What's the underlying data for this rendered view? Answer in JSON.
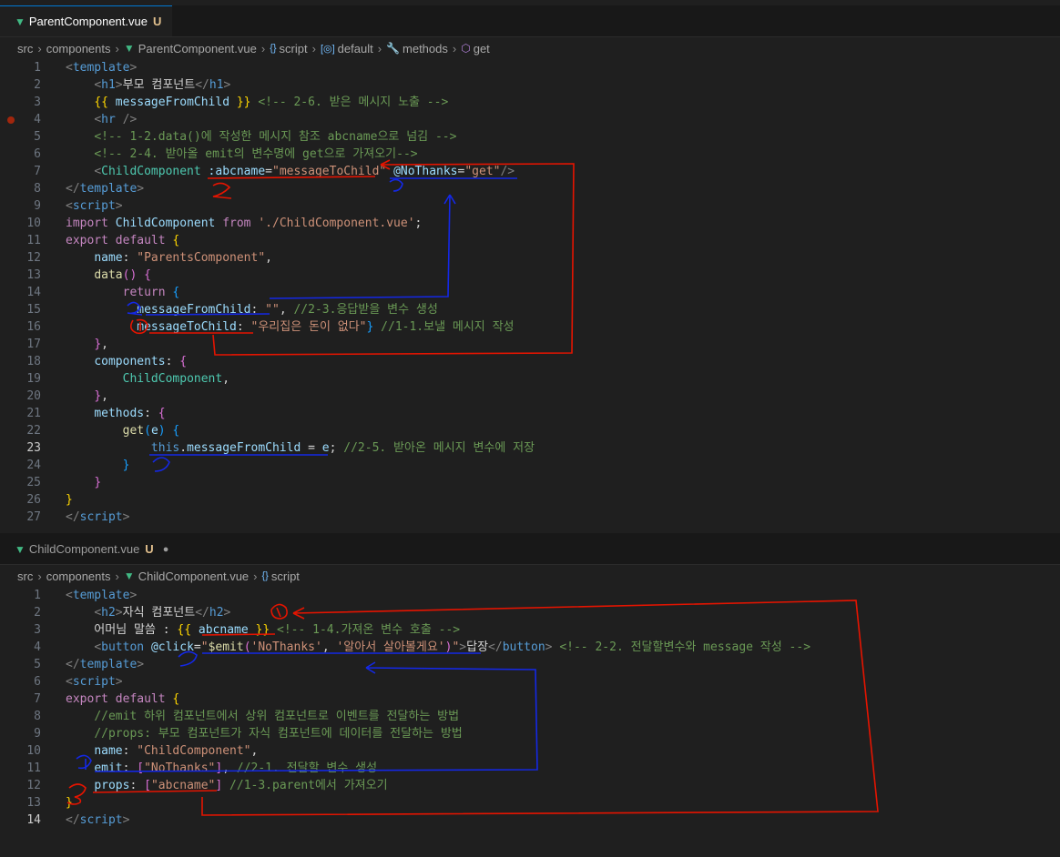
{
  "top": {
    "tab": {
      "label": "ParentComponent.vue",
      "status": "U"
    },
    "breadcrumb": [
      "src",
      "components",
      "ParentComponent.vue",
      "script",
      "default",
      "methods",
      "get"
    ],
    "lines": [
      {
        "n": "1",
        "parts": [
          [
            "t-br",
            "<"
          ],
          [
            "t-tag",
            "template"
          ],
          [
            "t-br",
            ">"
          ]
        ]
      },
      {
        "n": "2",
        "parts": [
          [
            "t-txt",
            "    "
          ],
          [
            "t-br",
            "<"
          ],
          [
            "t-tag",
            "h1"
          ],
          [
            "t-br",
            ">"
          ],
          [
            "t-txt",
            "부모 컴포넌트"
          ],
          [
            "t-br",
            "</"
          ],
          [
            "t-tag",
            "h1"
          ],
          [
            "t-br",
            ">"
          ]
        ]
      },
      {
        "n": "3",
        "parts": [
          [
            "t-txt",
            "    "
          ],
          [
            "t-gold",
            "{{"
          ],
          [
            "t-txt",
            " "
          ],
          [
            "t-var",
            "messageFromChild"
          ],
          [
            "t-txt",
            " "
          ],
          [
            "t-gold",
            "}}"
          ],
          [
            "t-txt",
            " "
          ],
          [
            "t-com",
            "<!-- 2-6. 받은 메시지 노출 -->"
          ]
        ]
      },
      {
        "n": "4",
        "bp": true,
        "parts": [
          [
            "t-txt",
            "    "
          ],
          [
            "t-br",
            "<"
          ],
          [
            "t-tag",
            "hr"
          ],
          [
            "t-txt",
            " "
          ],
          [
            "t-br",
            "/>"
          ]
        ]
      },
      {
        "n": "5",
        "parts": [
          [
            "t-txt",
            "    "
          ],
          [
            "t-com",
            "<!-- 1-2.data()에 작성한 메시지 참조 abcname으로 넘김 -->"
          ]
        ]
      },
      {
        "n": "6",
        "parts": [
          [
            "t-txt",
            "    "
          ],
          [
            "t-com",
            "<!-- 2-4. 받아올 emit의 변수명에 get으로 가져오기-->"
          ]
        ]
      },
      {
        "n": "7",
        "parts": [
          [
            "t-txt",
            "    "
          ],
          [
            "t-br",
            "<"
          ],
          [
            "t-cls",
            "ChildComponent"
          ],
          [
            "t-txt",
            " "
          ],
          [
            "t-attr",
            ":abcname"
          ],
          [
            "t-txt",
            "="
          ],
          [
            "t-str",
            "\"messageToChild\""
          ],
          [
            "t-txt",
            " "
          ],
          [
            "t-attr",
            "@NoThanks"
          ],
          [
            "t-txt",
            "="
          ],
          [
            "t-str",
            "\"get\""
          ],
          [
            "t-br",
            "/>"
          ]
        ]
      },
      {
        "n": "8",
        "parts": [
          [
            "t-br",
            "</"
          ],
          [
            "t-tag",
            "template"
          ],
          [
            "t-br",
            ">"
          ]
        ]
      },
      {
        "n": "9",
        "parts": [
          [
            "t-br",
            "<"
          ],
          [
            "t-tag",
            "script"
          ],
          [
            "t-br",
            ">"
          ]
        ]
      },
      {
        "n": "10",
        "parts": [
          [
            "t-kw",
            "import"
          ],
          [
            "t-txt",
            " "
          ],
          [
            "t-var",
            "ChildComponent"
          ],
          [
            "t-txt",
            " "
          ],
          [
            "t-kw",
            "from"
          ],
          [
            "t-txt",
            " "
          ],
          [
            "t-str",
            "'./ChildComponent.vue'"
          ],
          [
            "t-txt",
            ";"
          ]
        ]
      },
      {
        "n": "11",
        "parts": [
          [
            "t-kw",
            "export"
          ],
          [
            "t-txt",
            " "
          ],
          [
            "t-kw",
            "default"
          ],
          [
            "t-txt",
            " "
          ],
          [
            "t-gold",
            "{"
          ]
        ]
      },
      {
        "n": "12",
        "parts": [
          [
            "t-txt",
            "    "
          ],
          [
            "t-var",
            "name"
          ],
          [
            "t-txt",
            ": "
          ],
          [
            "t-str",
            "\"ParentsComponent\""
          ],
          [
            "t-txt",
            ","
          ]
        ]
      },
      {
        "n": "13",
        "parts": [
          [
            "t-txt",
            "    "
          ],
          [
            "t-fn",
            "data"
          ],
          [
            "t-pink",
            "()"
          ],
          [
            "t-txt",
            " "
          ],
          [
            "t-pink",
            "{"
          ]
        ]
      },
      {
        "n": "14",
        "parts": [
          [
            "t-txt",
            "        "
          ],
          [
            "t-kw",
            "return"
          ],
          [
            "t-txt",
            " "
          ],
          [
            "t-cbr",
            "{"
          ]
        ]
      },
      {
        "n": "15",
        "parts": [
          [
            "t-txt",
            "          "
          ],
          [
            "t-var",
            "messageFromChild"
          ],
          [
            "t-txt",
            ": "
          ],
          [
            "t-str",
            "\"\""
          ],
          [
            "t-txt",
            ", "
          ],
          [
            "t-com",
            "//2-3.응답받을 변수 생성"
          ]
        ]
      },
      {
        "n": "16",
        "parts": [
          [
            "t-txt",
            "          "
          ],
          [
            "t-var",
            "messageToChild"
          ],
          [
            "t-txt",
            ": "
          ],
          [
            "t-str",
            "\"우리집은 돈이 없다\""
          ],
          [
            "t-cbr",
            "}"
          ],
          [
            "t-txt",
            " "
          ],
          [
            "t-com",
            "//1-1.보낼 메시지 작성"
          ]
        ]
      },
      {
        "n": "17",
        "parts": [
          [
            "t-txt",
            "    "
          ],
          [
            "t-pink",
            "}"
          ],
          [
            "t-txt",
            ","
          ]
        ]
      },
      {
        "n": "18",
        "parts": [
          [
            "t-txt",
            "    "
          ],
          [
            "t-var",
            "components"
          ],
          [
            "t-txt",
            ": "
          ],
          [
            "t-pink",
            "{"
          ]
        ]
      },
      {
        "n": "19",
        "parts": [
          [
            "t-txt",
            "        "
          ],
          [
            "t-cls",
            "ChildComponent"
          ],
          [
            "t-txt",
            ","
          ]
        ]
      },
      {
        "n": "20",
        "parts": [
          [
            "t-txt",
            "    "
          ],
          [
            "t-pink",
            "}"
          ],
          [
            "t-txt",
            ","
          ]
        ]
      },
      {
        "n": "21",
        "parts": [
          [
            "t-txt",
            "    "
          ],
          [
            "t-var",
            "methods"
          ],
          [
            "t-txt",
            ": "
          ],
          [
            "t-pink",
            "{"
          ]
        ]
      },
      {
        "n": "22",
        "parts": [
          [
            "t-txt",
            "        "
          ],
          [
            "t-fn",
            "get"
          ],
          [
            "t-cbr",
            "("
          ],
          [
            "t-var",
            "e"
          ],
          [
            "t-cbr",
            ")"
          ],
          [
            "t-txt",
            " "
          ],
          [
            "t-cbr",
            "{"
          ]
        ]
      },
      {
        "n": "23",
        "cur": true,
        "parts": [
          [
            "t-txt",
            "            "
          ],
          [
            "t-blue",
            "this"
          ],
          [
            "t-txt",
            "."
          ],
          [
            "t-var",
            "messageFromChild"
          ],
          [
            "t-txt",
            " = "
          ],
          [
            "t-var",
            "e"
          ],
          [
            "t-txt",
            "; "
          ],
          [
            "t-com",
            "//2-5. 받아온 메시지 변수에 저장"
          ]
        ]
      },
      {
        "n": "24",
        "parts": [
          [
            "t-txt",
            "        "
          ],
          [
            "t-cbr",
            "}"
          ]
        ]
      },
      {
        "n": "25",
        "parts": [
          [
            "t-txt",
            "    "
          ],
          [
            "t-pink",
            "}"
          ]
        ]
      },
      {
        "n": "26",
        "parts": [
          [
            "t-gold",
            "}"
          ]
        ]
      },
      {
        "n": "27",
        "parts": [
          [
            "t-br",
            "</"
          ],
          [
            "t-tag",
            "script"
          ],
          [
            "t-br",
            ">"
          ]
        ]
      }
    ]
  },
  "bottom": {
    "tab": {
      "label": "ChildComponent.vue",
      "status": "U"
    },
    "breadcrumb": [
      "src",
      "components",
      "ChildComponent.vue",
      "script"
    ],
    "lines": [
      {
        "n": "1",
        "parts": [
          [
            "t-br",
            "<"
          ],
          [
            "t-tag",
            "template"
          ],
          [
            "t-br",
            ">"
          ]
        ]
      },
      {
        "n": "2",
        "parts": [
          [
            "t-txt",
            "    "
          ],
          [
            "t-br",
            "<"
          ],
          [
            "t-tag",
            "h2"
          ],
          [
            "t-br",
            ">"
          ],
          [
            "t-txt",
            "자식 컴포넌트"
          ],
          [
            "t-br",
            "</"
          ],
          [
            "t-tag",
            "h2"
          ],
          [
            "t-br",
            ">"
          ]
        ]
      },
      {
        "n": "3",
        "parts": [
          [
            "t-txt",
            "    어머님 말씀 : "
          ],
          [
            "t-gold",
            "{{"
          ],
          [
            "t-txt",
            " "
          ],
          [
            "t-var",
            "abcname"
          ],
          [
            "t-txt",
            " "
          ],
          [
            "t-gold",
            "}}"
          ],
          [
            "t-txt",
            " "
          ],
          [
            "t-com",
            "<!-- 1-4.가져온 변수 호출 -->"
          ]
        ]
      },
      {
        "n": "4",
        "parts": [
          [
            "t-txt",
            "    "
          ],
          [
            "t-br",
            "<"
          ],
          [
            "t-tag",
            "button"
          ],
          [
            "t-txt",
            " "
          ],
          [
            "t-attr",
            "@click"
          ],
          [
            "t-txt",
            "="
          ],
          [
            "t-str",
            "\""
          ],
          [
            "t-fn",
            "$emit"
          ],
          [
            "t-pink",
            "("
          ],
          [
            "t-str",
            "'NoThanks'"
          ],
          [
            "t-txt",
            ", "
          ],
          [
            "t-str",
            "'알아서 살아볼게요'"
          ],
          [
            "t-pink",
            ")"
          ],
          [
            "t-str",
            "\""
          ],
          [
            "t-br",
            ">"
          ],
          [
            "t-txt",
            "답장"
          ],
          [
            "t-br",
            "</"
          ],
          [
            "t-tag",
            "button"
          ],
          [
            "t-br",
            ">"
          ],
          [
            "t-txt",
            " "
          ],
          [
            "t-com",
            "<!-- 2-2. 전달할변수와 message 작성 -->"
          ]
        ]
      },
      {
        "n": "5",
        "parts": [
          [
            "t-br",
            "</"
          ],
          [
            "t-tag",
            "template"
          ],
          [
            "t-br",
            ">"
          ]
        ]
      },
      {
        "n": "6",
        "parts": [
          [
            "t-br",
            "<"
          ],
          [
            "t-tag",
            "script"
          ],
          [
            "t-br",
            ">"
          ]
        ]
      },
      {
        "n": "7",
        "parts": [
          [
            "t-kw",
            "export"
          ],
          [
            "t-txt",
            " "
          ],
          [
            "t-kw",
            "default"
          ],
          [
            "t-txt",
            " "
          ],
          [
            "t-gold",
            "{"
          ]
        ]
      },
      {
        "n": "8",
        "parts": [
          [
            "t-txt",
            "    "
          ],
          [
            "t-com",
            "//emit 하위 컴포넌트에서 상위 컴포넌트로 이벤트를 전달하는 방법"
          ]
        ]
      },
      {
        "n": "9",
        "parts": [
          [
            "t-txt",
            "    "
          ],
          [
            "t-com",
            "//props: 부모 컴포넌트가 자식 컴포넌트에 데이터를 전달하는 방법"
          ]
        ]
      },
      {
        "n": "10",
        "parts": [
          [
            "t-txt",
            "    "
          ],
          [
            "t-var",
            "name"
          ],
          [
            "t-txt",
            ": "
          ],
          [
            "t-str",
            "\"ChildComponent\""
          ],
          [
            "t-txt",
            ","
          ]
        ]
      },
      {
        "n": "11",
        "parts": [
          [
            "t-txt",
            "    "
          ],
          [
            "t-var",
            "emit"
          ],
          [
            "t-txt",
            ": "
          ],
          [
            "t-pink",
            "["
          ],
          [
            "t-str",
            "\"NoThanks\""
          ],
          [
            "t-pink",
            "]"
          ],
          [
            "t-txt",
            ", "
          ],
          [
            "t-com",
            "//2-1. 전달할 변수 생성"
          ]
        ]
      },
      {
        "n": "12",
        "parts": [
          [
            "t-txt",
            "    "
          ],
          [
            "t-var",
            "props"
          ],
          [
            "t-txt",
            ": "
          ],
          [
            "t-pink",
            "["
          ],
          [
            "t-str",
            "\"abcname\""
          ],
          [
            "t-pink",
            "]"
          ],
          [
            "t-txt",
            " "
          ],
          [
            "t-com",
            "//1-3.parent에서 가져오기"
          ]
        ]
      },
      {
        "n": "13",
        "parts": [
          [
            "t-gold",
            "}"
          ]
        ]
      },
      {
        "n": "14",
        "cur": true,
        "parts": [
          [
            "t-br",
            "</"
          ],
          [
            "t-tag",
            "script"
          ],
          [
            "t-br",
            ">"
          ]
        ]
      }
    ]
  },
  "annotations": {
    "red_color": "#e51400",
    "blue_color": "#1428e6",
    "marks": [
      "1",
      "2",
      "3",
      "4",
      "1",
      "2",
      "3",
      "4",
      "5"
    ]
  }
}
